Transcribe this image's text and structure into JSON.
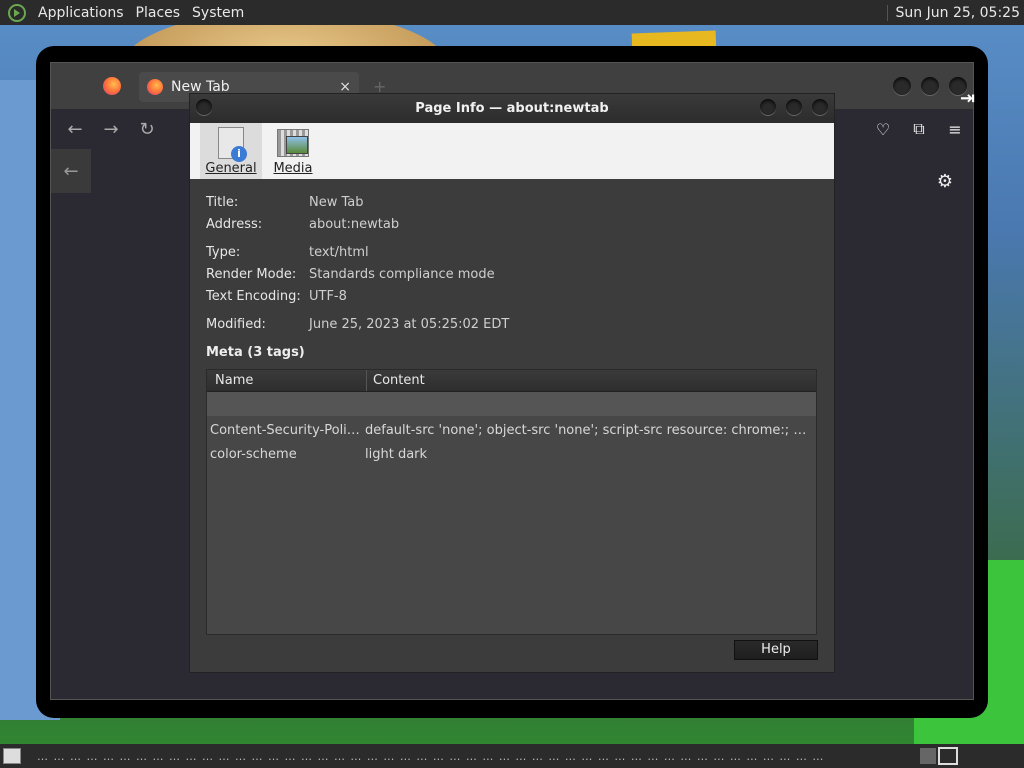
{
  "top_panel": {
    "menus": [
      "Applications",
      "Places",
      "System"
    ],
    "clock": "Sun Jun 25, 05:25"
  },
  "firefox": {
    "tab_title": "New Tab",
    "tab_close": "×",
    "new_tab": "+",
    "nav": {
      "back": "←",
      "forward": "→",
      "reload": "↻",
      "pocket": "♡",
      "extensions": "⧉",
      "menu": "≡"
    },
    "sidebar_back": "←",
    "settings": "⚙"
  },
  "dialog": {
    "title": "Page Info — about:newtab",
    "toolbar": [
      {
        "label": "General",
        "icon": "general-icon",
        "active": true
      },
      {
        "label": "Media",
        "icon": "media-icon",
        "active": false
      }
    ],
    "fields": {
      "title_label": "Title:",
      "title_value": "New Tab",
      "address_label": "Address:",
      "address_value": "about:newtab",
      "type_label": "Type:",
      "type_value": "text/html",
      "render_label": "Render Mode:",
      "render_value": "Standards compliance mode",
      "encoding_label": "Text Encoding:",
      "encoding_value": "UTF-8",
      "modified_label": "Modified:",
      "modified_value": "June 25, 2023 at 05:25:02 EDT"
    },
    "meta_heading": "Meta (3 tags)",
    "table": {
      "headers": [
        "Name",
        "Content"
      ],
      "rows": [
        {
          "name": "Content-Security-Polic…",
          "content": "default-src 'none'; object-src 'none'; script-src resource: chrome:; connec…"
        },
        {
          "name": "color-scheme",
          "content": "light dark"
        }
      ]
    },
    "help_button": "Help"
  },
  "bottom_panel": {
    "dots": "… … … … … … … … … … … … … … … … … … … … … … … … … … … … … … … … … … … … … … … … … … … … … … … …"
  }
}
